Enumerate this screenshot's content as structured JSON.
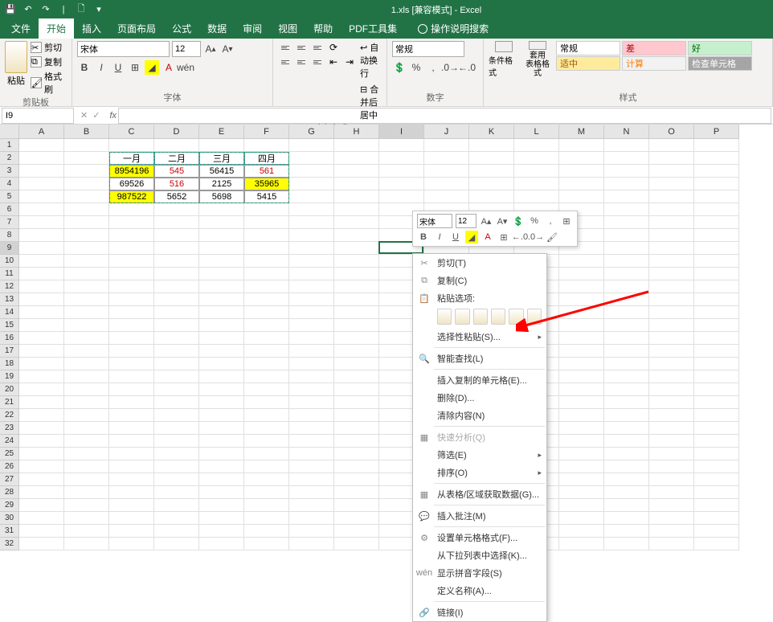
{
  "title": "1.xls [兼容模式] - Excel",
  "tabs": [
    "文件",
    "开始",
    "插入",
    "页面布局",
    "公式",
    "数据",
    "审阅",
    "视图",
    "帮助",
    "PDF工具集"
  ],
  "tellme": "操作说明搜索",
  "ribbon": {
    "clipboard": {
      "label": "剪贴板",
      "paste": "粘贴",
      "cut": "剪切",
      "copy": "复制",
      "painter": "格式刷"
    },
    "font": {
      "label": "字体",
      "name": "宋体",
      "size": "12"
    },
    "align": {
      "label": "对齐方式",
      "wrap": "自动换行",
      "merge": "合并后居中"
    },
    "number": {
      "label": "数字",
      "format": "常规"
    },
    "styles": {
      "label": "样式",
      "cond": "条件格式",
      "table": "套用\n表格格式",
      "normal": "常规",
      "good": "好",
      "bad": "差",
      "neutral": "适中",
      "calc": "计算",
      "check": "检查单元格"
    }
  },
  "namebox": "I9",
  "colWidths": {
    "std": 56,
    "A": 58
  },
  "cols": [
    "A",
    "B",
    "C",
    "D",
    "E",
    "F",
    "G",
    "H",
    "I",
    "J",
    "K",
    "L",
    "M",
    "N",
    "O",
    "P"
  ],
  "rows": 32,
  "table": {
    "headers": [
      "一月",
      "二月",
      "三月",
      "四月"
    ],
    "data": [
      {
        "c": "8954196",
        "d": "545",
        "e": "56415",
        "f": "561",
        "hl": [
          "C"
        ],
        "red": [
          "D",
          "F"
        ]
      },
      {
        "c": "69526",
        "d": "516",
        "e": "2125",
        "f": "35965",
        "hl": [
          "F"
        ],
        "red": [
          "D"
        ]
      },
      {
        "c": "987522",
        "d": "5652",
        "e": "5698",
        "f": "5415",
        "hl": [
          "C"
        ],
        "red": []
      }
    ]
  },
  "miniToolbar": {
    "font": "宋体",
    "size": "12"
  },
  "contextMenu": {
    "cut": "剪切(T)",
    "copy": "复制(C)",
    "pasteOptions": "粘贴选项:",
    "pasteSpecial": "选择性粘贴(S)...",
    "smartLookup": "智能查找(L)",
    "insertCopied": "插入复制的单元格(E)...",
    "delete": "删除(D)...",
    "clear": "清除内容(N)",
    "quickAnalysis": "快速分析(Q)",
    "filter": "筛选(E)",
    "sort": "排序(O)",
    "getData": "从表格/区域获取数据(G)...",
    "insertComment": "插入批注(M)",
    "formatCells": "设置单元格格式(F)...",
    "dropdown": "从下拉列表中选择(K)...",
    "phonetic": "显示拼音字段(S)",
    "defineName": "定义名称(A)...",
    "link": "链接(I)"
  }
}
